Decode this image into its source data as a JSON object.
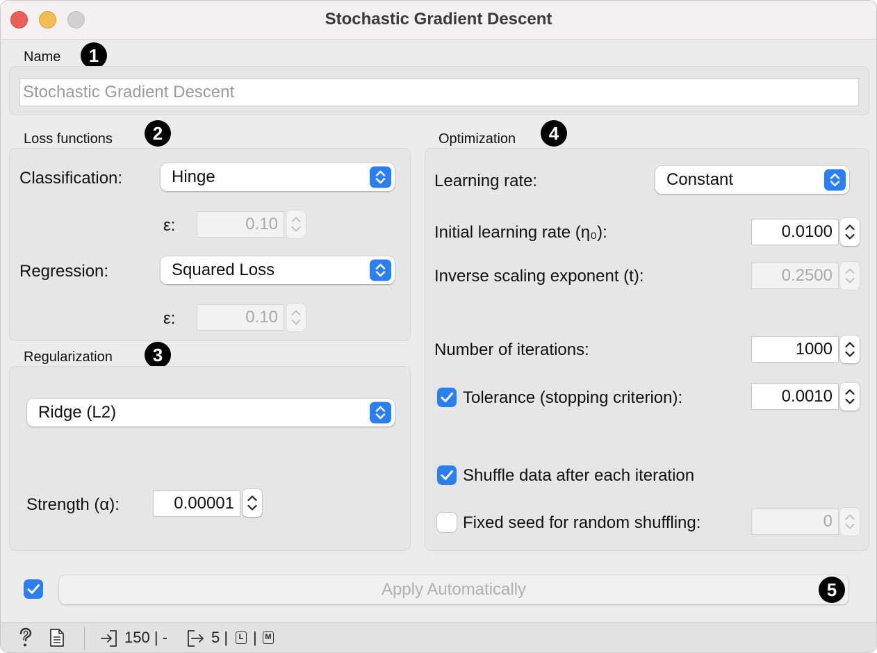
{
  "window": {
    "title": "Stochastic Gradient Descent"
  },
  "name_section": {
    "label": "Name",
    "badge": "1",
    "value": "Stochastic Gradient Descent"
  },
  "loss": {
    "label": "Loss functions",
    "badge": "2",
    "classification_label": "Classification:",
    "classification_value": "Hinge",
    "epsilon_label": "ε:",
    "classification_epsilon": "0.10",
    "regression_label": "Regression:",
    "regression_value": "Squared Loss",
    "regression_epsilon": "0.10"
  },
  "regularization": {
    "label": "Regularization",
    "badge": "3",
    "method": "Ridge (L2)",
    "strength_label": "Strength (α):",
    "strength_value": "0.00001"
  },
  "optimization": {
    "label": "Optimization",
    "badge": "4",
    "learning_rate_label": "Learning rate:",
    "learning_rate_value": "Constant",
    "initial_lr_label": "Initial learning rate (η₀):",
    "initial_lr_value": "0.0100",
    "inverse_scaling_label": "Inverse scaling exponent (t):",
    "inverse_scaling_value": "0.2500",
    "iterations_label": "Number of iterations:",
    "iterations_value": "1000",
    "tolerance_label": "Tolerance (stopping criterion):",
    "tolerance_value": "0.0010",
    "tolerance_checked": true,
    "shuffle_label": "Shuffle data after each iteration",
    "shuffle_checked": true,
    "seed_label": "Fixed seed for random shuffling:",
    "seed_value": "0",
    "seed_checked": false
  },
  "apply": {
    "label": "Apply Automatically",
    "badge": "5",
    "checked": true
  },
  "statusbar": {
    "input_count": "150 | -",
    "output_count": "5 |",
    "mini_l": "L",
    "mini_m": "M"
  },
  "colors": {
    "accent": "#2a7ff4",
    "close": "#ec5f57",
    "minimize": "#f4bd4f"
  }
}
